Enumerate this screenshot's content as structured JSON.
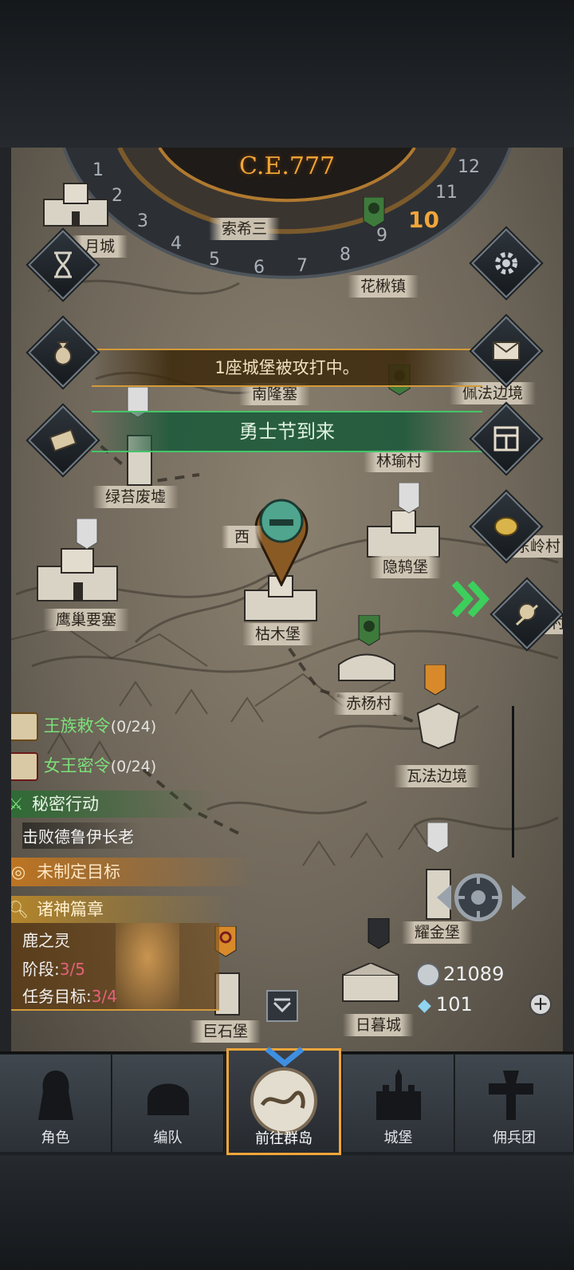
{
  "calendar": {
    "era": "C.E.777",
    "numbers": [
      "1",
      "2",
      "3",
      "4",
      "5",
      "6",
      "7",
      "8",
      "9",
      "10",
      "11",
      "12"
    ],
    "current_month": "10"
  },
  "banners": {
    "siege": "1座城堡被攻打中。",
    "festival": "勇士节到来"
  },
  "locations": [
    {
      "name": "月城"
    },
    {
      "name": "索希三"
    },
    {
      "name": "花楸镇"
    },
    {
      "name": "佩法边境"
    },
    {
      "name": "南隆塞"
    },
    {
      "name": "林瑜村"
    },
    {
      "name": "绿苔废墟"
    },
    {
      "name": "西"
    },
    {
      "name": "东岭村"
    },
    {
      "name": "隐鸫堡"
    },
    {
      "name": "鹰巢要塞"
    },
    {
      "name": "枯木堡"
    },
    {
      "name": "花源村"
    },
    {
      "name": "赤杨村"
    },
    {
      "name": "瓦法边境"
    },
    {
      "name": "耀金堡"
    },
    {
      "name": "巨石堡"
    },
    {
      "name": "日暮城"
    }
  ],
  "quests": {
    "royal_edict": {
      "label": "王族敕令",
      "progress": "(0/24)"
    },
    "queen_order": {
      "label": "女王密令",
      "progress": "(0/24)"
    },
    "secret_op": {
      "label": "秘密行动",
      "objective": "击败德鲁伊长老"
    },
    "unset_goal": {
      "label": "未制定目标"
    },
    "gods_chapter": {
      "label": "诸神篇章",
      "name": "鹿之灵",
      "stage_label": "阶段:",
      "stage_value": "3/5",
      "goal_label": "任务目标:",
      "goal_value": "3/4"
    }
  },
  "resources": {
    "silver": "21089",
    "crystal": "101"
  },
  "right_menu_icons": [
    "gear-icon",
    "mail-icon",
    "grid-icon",
    "coin-icon",
    "mercenary-icon"
  ],
  "left_menu_icons": [
    "hourglass-icon",
    "bag-icon",
    "scroll-icon"
  ],
  "bottom_tabs": [
    {
      "label": "角色",
      "icon": "knight-icon"
    },
    {
      "label": "编队",
      "icon": "helmet-icon"
    },
    {
      "label": "前往群岛",
      "icon": "islands-icon",
      "active": true
    },
    {
      "label": "城堡",
      "icon": "castle-icon"
    },
    {
      "label": "佣兵团",
      "icon": "mercenary-tab-icon"
    }
  ],
  "colors": {
    "accent_gold": "#f0a63a",
    "quest_green": "#7be07a",
    "stage_red": "#e5627a",
    "festival_green": "#46c46a"
  }
}
